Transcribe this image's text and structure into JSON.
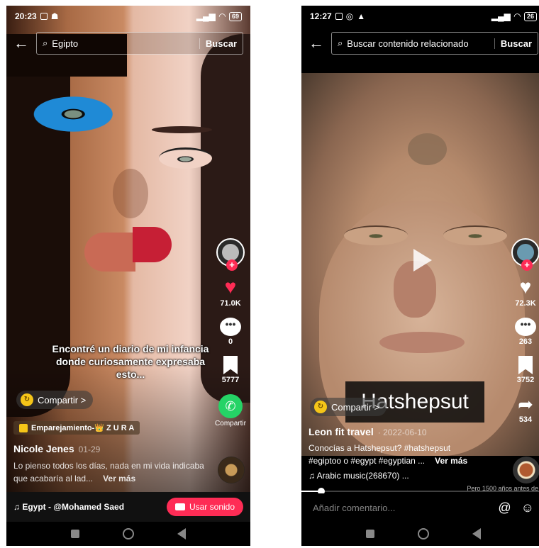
{
  "left": {
    "status": {
      "time": "20:23",
      "battery": "69"
    },
    "search": {
      "query": "Egipto",
      "button": "Buscar"
    },
    "caption": "Encontré un diario de mi infancia donde curiosamente expresaba esto...",
    "actions": {
      "likes": "71.0K",
      "comments": "0",
      "saves": "5777",
      "share": "Compartir"
    },
    "compartir_pill": "Compartir >",
    "effect_tag": "Emparejamiento-👑 Z U R A",
    "author": "Nicole Jenes",
    "date": "01-29",
    "description": "Lo pienso todos los días, nada en mi vida indicaba que acabaría al lad...",
    "ver_mas": "Ver más",
    "music": "Egypt - @Mohamed Saed",
    "use_sound": "Usar sonido"
  },
  "right": {
    "status": {
      "time": "12:27",
      "battery": "26"
    },
    "search": {
      "query": "Buscar contenido relacionado",
      "button": "Buscar"
    },
    "overlay_title": "Hatshepsut",
    "actions": {
      "likes": "72.3K",
      "comments": "263",
      "saves": "3752",
      "shares": "534"
    },
    "compartir_pill": "Compartir >",
    "author": "Leon fit travel",
    "date": "· 2022-06-10",
    "description_line1": "Conocías a Hatshepsut? #hatshepsut",
    "description_line2": "#egiptoo o #egypt  #egyptian ...",
    "ver_mas": "Ver más",
    "music": "Arabic music(268670) ...",
    "hint": "Pero 1500 años antes de",
    "progress": 0.08,
    "comment_placeholder": "Añadir comentario..."
  },
  "colors": {
    "accent": "#fe2c55",
    "whatsapp": "#25d366",
    "coin": "#f5c518"
  }
}
